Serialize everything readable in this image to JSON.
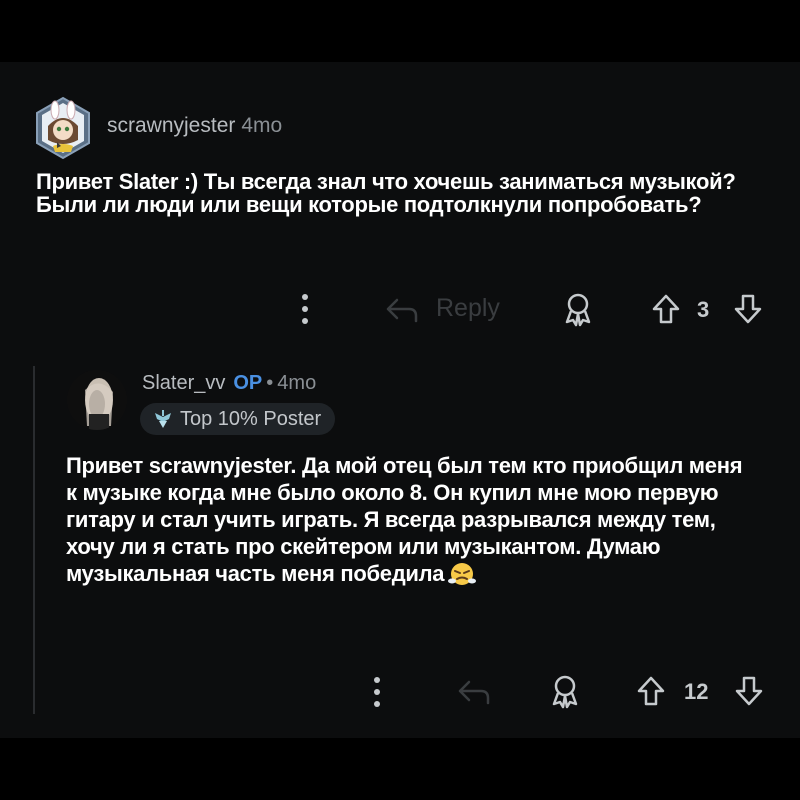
{
  "comments": [
    {
      "username": "scrawnyjester",
      "age": "4mo",
      "text": "Привет Slater :) Ты всегда знал что хочешь заниматься музыкой? Были ли люди или вещи которые подтолкнули попробовать?",
      "reply_label": "Reply",
      "votes": "3"
    },
    {
      "username": "Slater_vv",
      "op_label": "OP",
      "separator": "•",
      "age": "4mo",
      "badge": "Top 10% Poster",
      "text": "Привет scrawnyjester. Да мой отец был тем кто приобщил меня к музыке когда мне было около 8. Он купил мне мою первую гитару и стал учить играть. Я всегда разрывался между тем, хочу ли я стать про скейтером или музыкантом. Думаю музыкальная часть меня победила",
      "emoji": "triumph-face-emoji",
      "votes": "12"
    }
  ],
  "colors": {
    "background": "#000000",
    "panel": "#0c0d0e",
    "op_accent": "#4a90e2",
    "text": "#ffffff",
    "muted": "#9aa0a6"
  }
}
